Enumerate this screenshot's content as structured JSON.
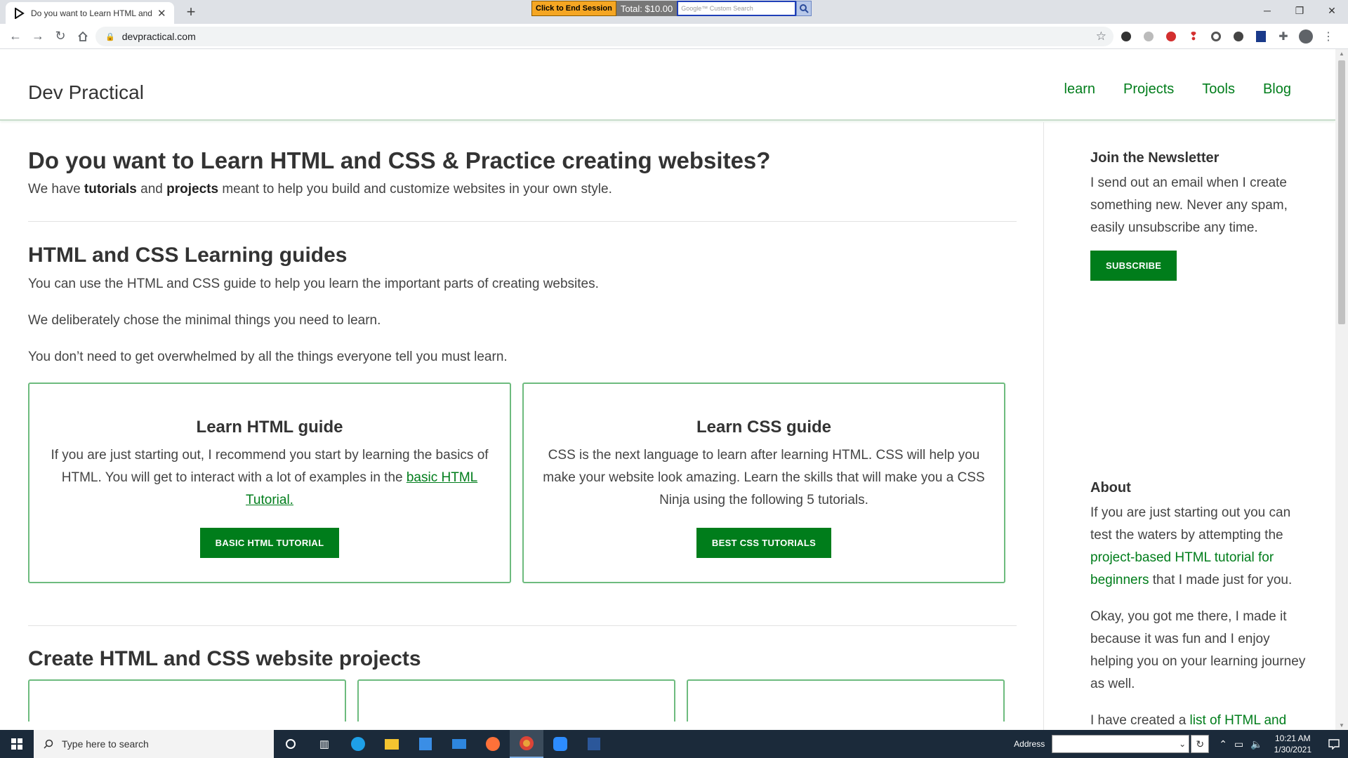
{
  "browser": {
    "tab_title": "Do you want to Learn HTML and CSS & Practice creating websites?",
    "url": "devpractical.com",
    "overlay": {
      "end_session_label": "Click to End Session",
      "total_label": "Total: $10.00",
      "search_placeholder": "Google™ Custom Search"
    }
  },
  "site": {
    "title": "Dev Practical",
    "nav": [
      "learn",
      "Projects",
      "Tools",
      "Blog"
    ]
  },
  "hero": {
    "heading": "Do you want to Learn HTML and CSS & Practice creating websites?",
    "text_1": "We have ",
    "strong_1": "tutorials",
    "text_2": " and ",
    "strong_2": "projects",
    "text_3": " meant to help you build and customize websites in your own style."
  },
  "guides": {
    "heading": "HTML and CSS Learning guides",
    "paragraphs": [
      "You can use the HTML and CSS guide to help you learn the important parts of creating websites.",
      "We deliberately chose the minimal things you need to learn.",
      "You don’t need to get overwhelmed by all the things everyone tell you must learn."
    ],
    "cards": [
      {
        "title": "Learn HTML guide",
        "text": "If you are just starting out, I recommend you start by learning the basics of HTML. You will get to interact with a lot of examples in the ",
        "link": "basic HTML Tutorial.",
        "button": "BASIC HTML TUTORIAL"
      },
      {
        "title": "Learn CSS guide",
        "text": "CSS is the next language to learn after learning HTML. CSS will help you make your website look amazing. Learn the skills that will make you a CSS Ninja using the following 5 tutorials.",
        "button": "BEST CSS TUTORIALS"
      }
    ]
  },
  "projects": {
    "heading": "Create HTML and CSS website projects"
  },
  "sidebar": {
    "newsletter": {
      "heading": "Join the Newsletter",
      "text": "I send out an email when I create something new. Never any spam, easily unsubscribe any time.",
      "button": "SUBSCRIBE"
    },
    "about": {
      "heading": "About",
      "p1_text": "If you are just starting out you can test the waters by attempting the ",
      "p1_link": "project-based HTML tutorial for beginners",
      "p1_tail": " that I made just for you.",
      "p2": "Okay, you got me there, I made it because it was fun and I enjoy helping you on your learning journey as well.",
      "p3_text": "I have created a ",
      "p3_link": "list of HTML and"
    }
  },
  "taskbar": {
    "search_placeholder": "Type here to search",
    "address_label": "Address",
    "time": "10:21 AM",
    "date": "1/30/2021"
  },
  "colors": {
    "accent_green": "#007d1b",
    "card_border": "#6dbb7e"
  }
}
